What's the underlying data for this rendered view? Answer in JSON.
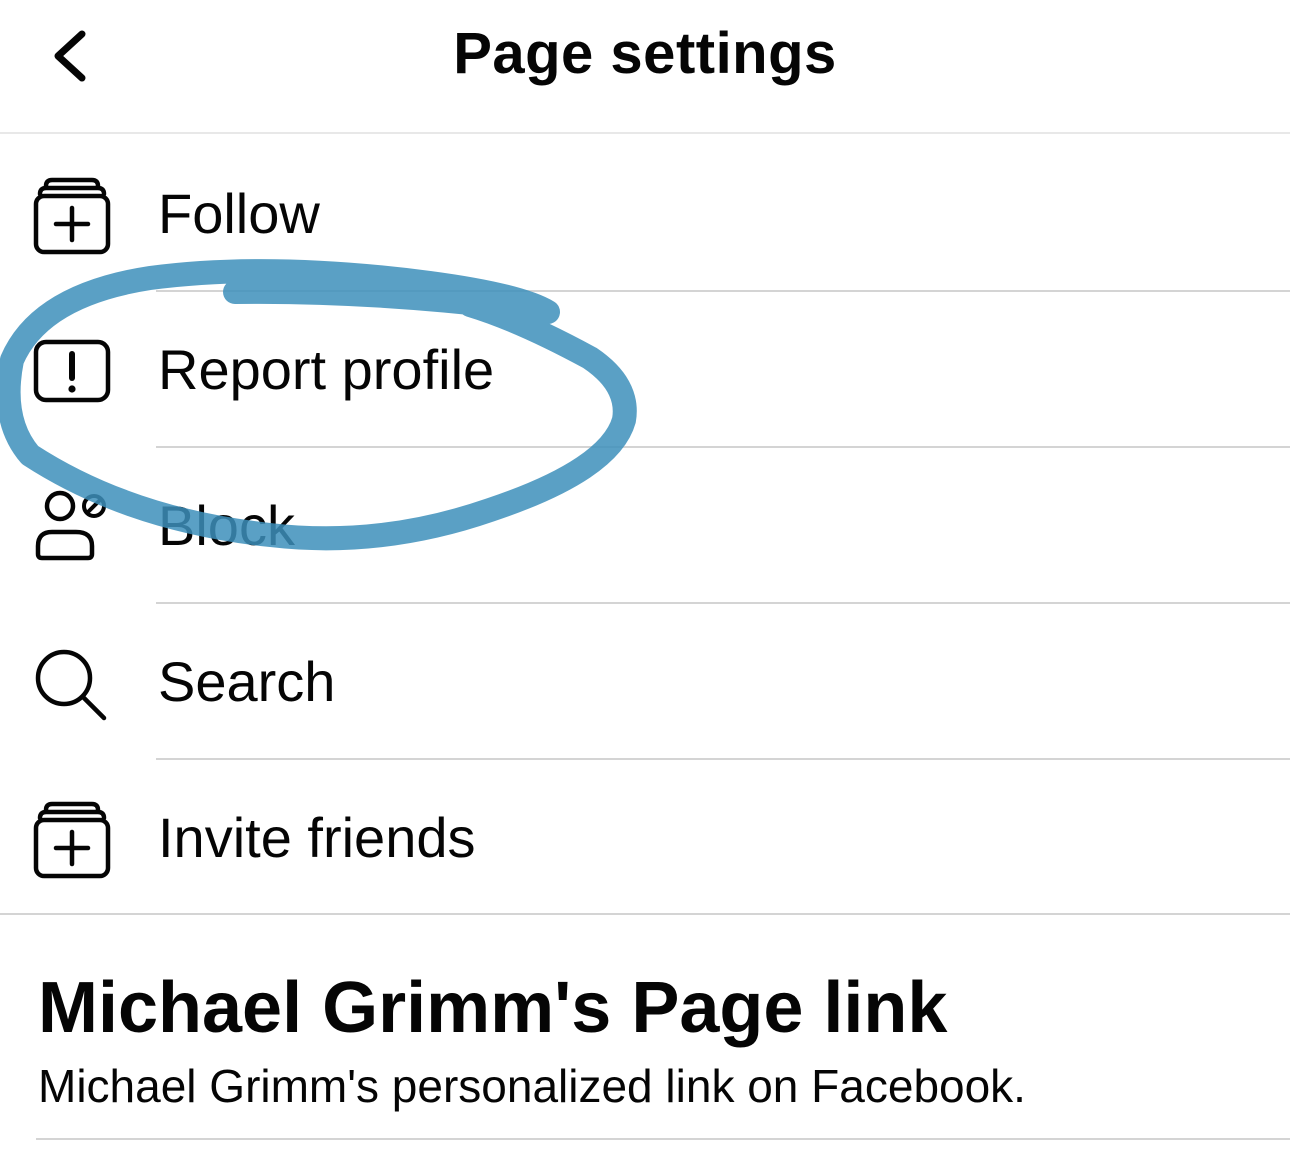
{
  "header": {
    "title": "Page settings",
    "back_icon": "chevron-left-icon"
  },
  "menu": {
    "items": [
      {
        "label": "Follow",
        "icon": "follow-stack-plus-icon"
      },
      {
        "label": "Report profile",
        "icon": "report-exclamation-icon"
      },
      {
        "label": "Block",
        "icon": "block-person-icon"
      },
      {
        "label": "Search",
        "icon": "search-icon"
      },
      {
        "label": "Invite friends",
        "icon": "invite-stack-plus-icon"
      }
    ]
  },
  "page_link": {
    "title": "Michael Grimm's Page link",
    "description": "Michael Grimm's personalized link on Facebook."
  },
  "annotation": {
    "color": "#3d8fbb",
    "shape": "hand-drawn circle around Report profile"
  }
}
